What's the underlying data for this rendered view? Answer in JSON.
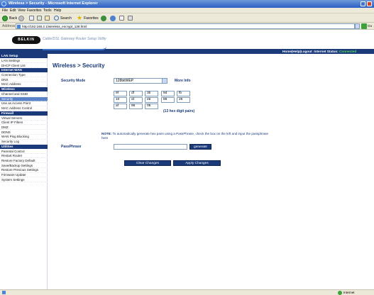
{
  "window": {
    "title": "Wireless > Security - Microsoft Internet Explorer"
  },
  "menu": [
    "File",
    "Edit",
    "View",
    "Favorites",
    "Tools",
    "Help"
  ],
  "toolbar": {
    "back_label": "Back",
    "search_label": "Search",
    "favorites_label": "Favorites"
  },
  "address": {
    "label": "Address",
    "url": "http://192.168.2.1/wireless_encrypt_128.html",
    "go_label": "Go"
  },
  "header": {
    "logo": "BELKIN",
    "subtitle": "Cable/DSL Gateway Router Setup Utility"
  },
  "navbar": {
    "links": "Home|Help|Logout",
    "internet_status_label": "Internet Status:",
    "internet_status_value": "Connected"
  },
  "sidebar": [
    {
      "type": "head",
      "label": "LAN Setup"
    },
    {
      "type": "item",
      "label": "LAN Settings"
    },
    {
      "type": "item",
      "label": "DHCP Client List"
    },
    {
      "type": "head",
      "label": "Internet WAN"
    },
    {
      "type": "item",
      "label": "Connection Type"
    },
    {
      "type": "item",
      "label": "DNS"
    },
    {
      "type": "item",
      "label": "MAC Address"
    },
    {
      "type": "head",
      "label": "Wireless"
    },
    {
      "type": "item",
      "label": "Channel and SSID"
    },
    {
      "type": "item",
      "label": "Security",
      "active": true
    },
    {
      "type": "item",
      "label": "Use as Access Point"
    },
    {
      "type": "item",
      "label": "MAC Address Control"
    },
    {
      "type": "head",
      "label": "Firewall"
    },
    {
      "type": "item",
      "label": "Virtual Servers"
    },
    {
      "type": "item",
      "label": "Client IP Filters"
    },
    {
      "type": "item",
      "label": "DMZ"
    },
    {
      "type": "item",
      "label": "DDNS"
    },
    {
      "type": "item",
      "label": "WAN Ping Blocking"
    },
    {
      "type": "item",
      "label": "Security Log"
    },
    {
      "type": "head",
      "label": "Utilities"
    },
    {
      "type": "item",
      "label": "Parental Control"
    },
    {
      "type": "item",
      "label": "Restart Router"
    },
    {
      "type": "item",
      "label": "Restore Factory Default"
    },
    {
      "type": "item",
      "label": "Save/Backup Settings"
    },
    {
      "type": "item",
      "label": "Restore Previous Settings"
    },
    {
      "type": "item",
      "label": "Firmware Update"
    },
    {
      "type": "item",
      "label": "System Settings"
    }
  ],
  "main": {
    "title": "Wireless > Security",
    "security_mode_label": "Security Mode",
    "security_mode_value": "128bitWEP",
    "more_info": "More Info",
    "hex_rows": [
      [
        "9f",
        "df",
        "3b",
        "9d",
        "fb"
      ],
      [
        "10",
        "af",
        "eb",
        "89",
        "25"
      ],
      [
        "af",
        "96",
        "05"
      ]
    ],
    "hex_note": "(13 hex digit pairs)",
    "note_tag": "NOTE:",
    "note_text": "To automatically generate hex pairs using a PassPhrase, check the box on the left and input the passphrase here",
    "passphrase_label": "PassPhrase",
    "passphrase_value": "",
    "generate_label": "generate",
    "clear_label": "Clear Changes",
    "apply_label": "Apply Changes"
  },
  "statusbar": {
    "zone": "Internet"
  }
}
